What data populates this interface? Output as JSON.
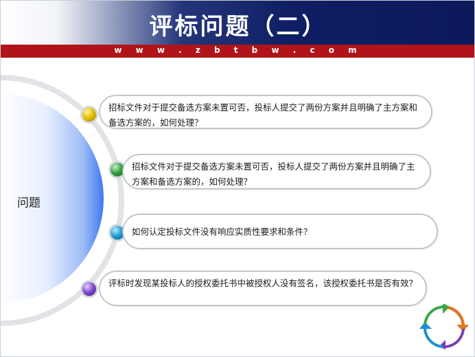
{
  "header": {
    "title": "评标问题（二）",
    "url": "w w w . z b t b w . c o m"
  },
  "left_label": "问题",
  "items": [
    {
      "text": "招标文件对于提交备选方案未置可否，投标人提交了两份方案并且明确了主方案和备选方案的，如何处理？",
      "dot_color": "#e6c40a"
    },
    {
      "text": "招标文件对于提交备选方案未置可否，投标人提交了两份方案并且明确了主方案和备选方案的，如何处理？",
      "dot_color": "#2e9c3a"
    },
    {
      "text": "如何认定投标文件没有响应实质性要求和条件？",
      "dot_color": "#1d9ad1"
    },
    {
      "text": "评标时发现某投标人的授权委托书中被授权人没有签名，该授权委托书是否有效？",
      "dot_color": "#7a47c9"
    }
  ],
  "colors": {
    "header_dark": "#0c1a5b",
    "redbar": "#b0141a",
    "arc_blue": "#3f78f0"
  },
  "icons": [
    "cycle-arrows-icon"
  ]
}
